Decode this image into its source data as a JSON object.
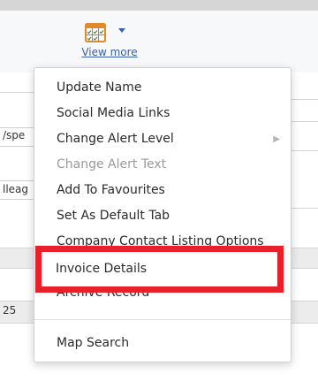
{
  "toolbar": {
    "view_more_label": "View more",
    "view_more_icon": "calendar-grid-icon"
  },
  "background": {
    "text_1": "/spe",
    "text_2": "lleag",
    "text_3": "25"
  },
  "menu": {
    "items": [
      {
        "label": "Update Name"
      },
      {
        "label": "Social Media Links"
      },
      {
        "label": "Change Alert Level",
        "submenu": true
      },
      {
        "label": "Change Alert Text",
        "disabled": true
      },
      {
        "label": "Add To Favourites"
      },
      {
        "label": "Set As Default Tab"
      },
      {
        "label": "Company Contact Listing Options"
      },
      {
        "label": "Archive Record"
      },
      {
        "label": "Map Search"
      }
    ],
    "submenu_arrow": "chevron-right-icon"
  },
  "highlight": {
    "label": "Invoice Details",
    "color": "#e8202a"
  }
}
